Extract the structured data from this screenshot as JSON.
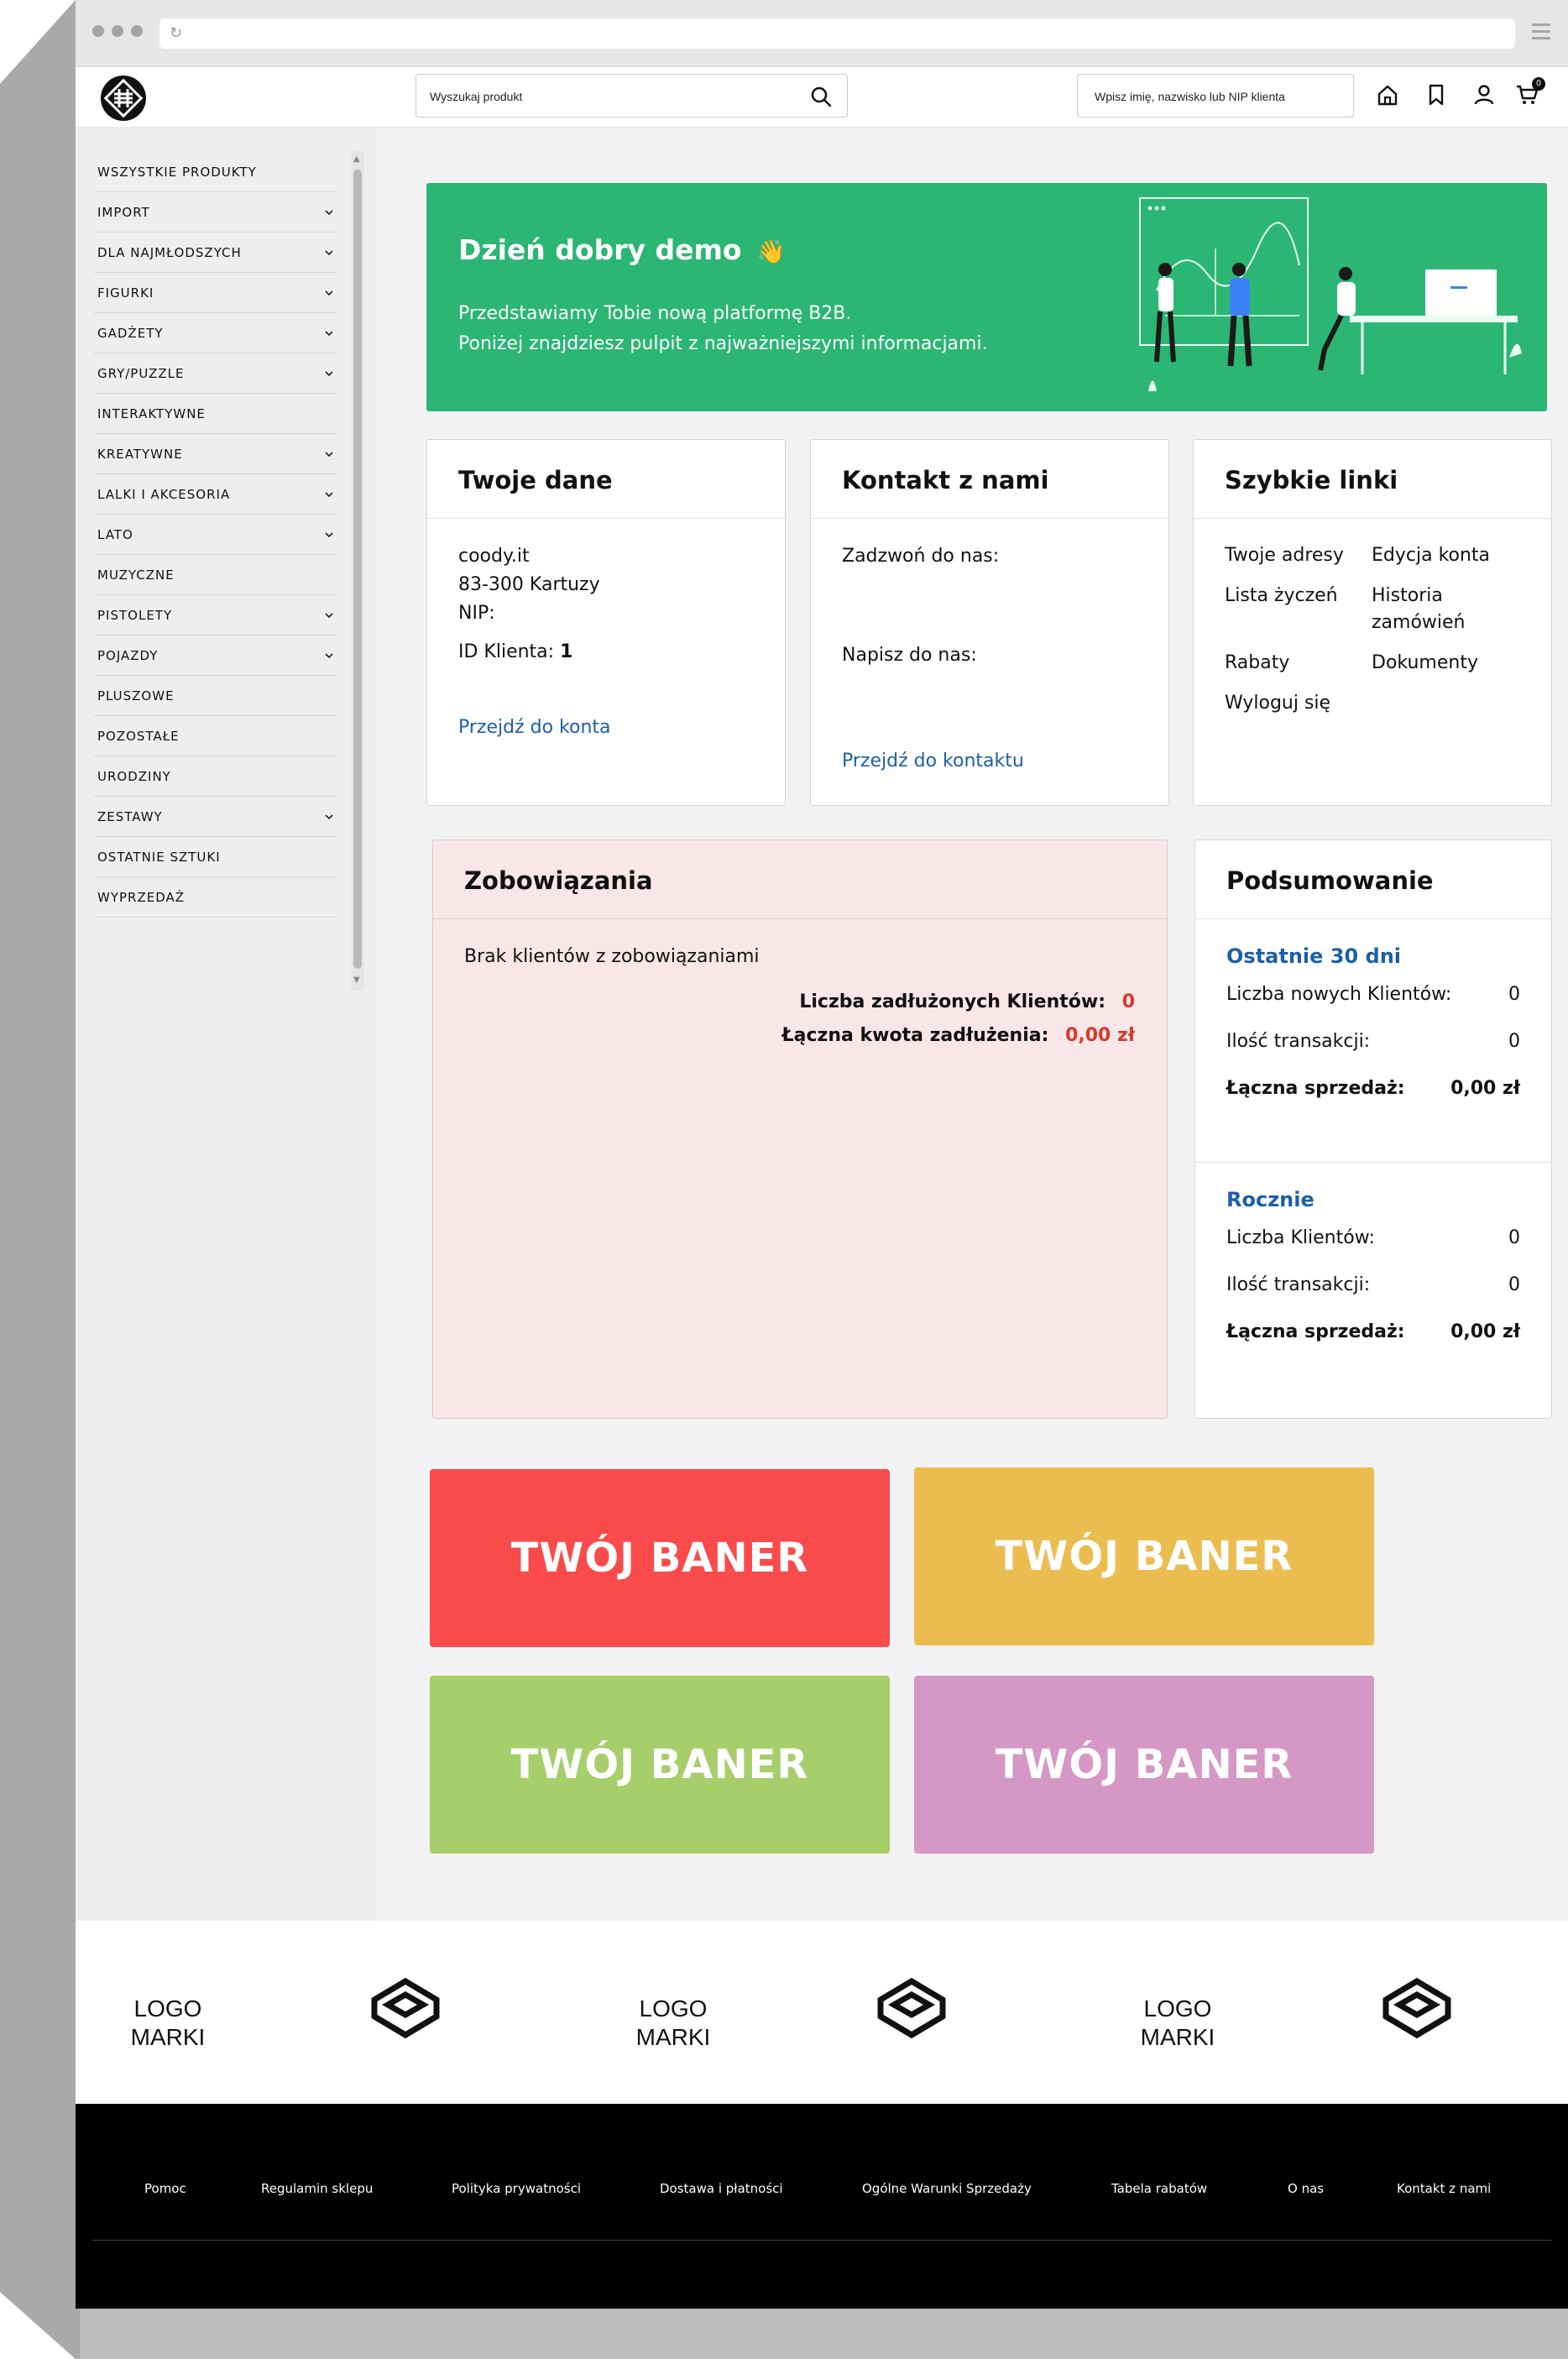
{
  "header": {
    "search_placeholder": "Wyszukaj produkt",
    "client_search_placeholder": "Wpisz imię, nazwisko lub NIP klienta",
    "cart_count": "0"
  },
  "sidebar": {
    "items": [
      {
        "label": "WSZYSTKIE PRODUKTY",
        "has_children": false
      },
      {
        "label": "IMPORT",
        "has_children": true
      },
      {
        "label": "DLA NAJMŁODSZYCH",
        "has_children": true
      },
      {
        "label": "FIGURKI",
        "has_children": true
      },
      {
        "label": "GADŻETY",
        "has_children": true
      },
      {
        "label": "GRY/PUZZLE",
        "has_children": true
      },
      {
        "label": "INTERAKTYWNE",
        "has_children": false
      },
      {
        "label": "KREATYWNE",
        "has_children": true
      },
      {
        "label": "LALKI I AKCESORIA",
        "has_children": true
      },
      {
        "label": "LATO",
        "has_children": true
      },
      {
        "label": "MUZYCZNE",
        "has_children": false
      },
      {
        "label": "PISTOLETY",
        "has_children": true
      },
      {
        "label": "POJAZDY",
        "has_children": true
      },
      {
        "label": "PLUSZOWE",
        "has_children": false
      },
      {
        "label": "POZOSTAŁE",
        "has_children": false
      },
      {
        "label": "URODZINY",
        "has_children": false
      },
      {
        "label": "ZESTAWY",
        "has_children": true
      },
      {
        "label": "OSTATNIE SZTUKI",
        "has_children": false
      },
      {
        "label": "WYPRZEDAŻ",
        "has_children": false
      }
    ]
  },
  "hero": {
    "title": "Dzień dobry demo",
    "emoji": "👋",
    "line1": "Przedstawiamy Tobie nową platformę B2B.",
    "line2": "Poniżej znajdziesz pulpit z najważniejszymi informacjami.",
    "bg_color": "#2bb673"
  },
  "your_data": {
    "title": "Twoje dane",
    "company": "coody.it",
    "address": "83-300 Kartuzy",
    "nip_label": "NIP:",
    "client_id_label": "ID Klienta:",
    "client_id": "1",
    "link": "Przejdź do konta"
  },
  "contact": {
    "title": "Kontakt z nami",
    "call_label": "Zadzwoń do nas:",
    "write_label": "Napisz do nas:",
    "link": "Przejdź do kontaktu"
  },
  "quick_links": {
    "title": "Szybkie linki",
    "links": [
      "Twoje adresy",
      "Edycja konta",
      "Lista życzeń",
      "Historia zamówień",
      "Rabaty",
      "Dokumenty",
      "Wyloguj się"
    ]
  },
  "obligations": {
    "title": "Zobowiązania",
    "empty_text": "Brak klientów z zobowiązaniami",
    "indebted_label": "Liczba zadłużonych Klientów:",
    "indebted_value": "0",
    "total_label": "Łączna kwota zadłużenia:",
    "total_value": "0,00 zł"
  },
  "summary": {
    "title": "Podsumowanie",
    "last30": {
      "title": "Ostatnie 30 dni",
      "new_clients_label": "Liczba nowych Klientów:",
      "new_clients": "0",
      "transactions_label": "Ilość transakcji:",
      "transactions": "0",
      "sales_label": "Łączna sprzedaż:",
      "sales": "0,00 zł"
    },
    "yearly": {
      "title": "Rocznie",
      "clients_label": "Liczba Klientów:",
      "clients": "0",
      "transactions_label": "Ilość transakcji:",
      "transactions": "0",
      "sales_label": "Łączna sprzedaż:",
      "sales": "0,00 zł"
    }
  },
  "banners": [
    {
      "label": "TWÓJ BANER",
      "color": "#f94b4b"
    },
    {
      "label": "TWÓJ BANER",
      "color": "#ebbd50"
    },
    {
      "label": "TWÓJ BANER",
      "color": "#a6ce6a"
    },
    {
      "label": "TWÓJ BANER",
      "color": "#d597c6"
    }
  ],
  "brands": [
    {
      "text_line1": "LOGO",
      "text_line2": "MARKI"
    },
    {
      "text_line1": "LOGO",
      "text_line2": "MARKI"
    },
    {
      "text_line1": "LOGO",
      "text_line2": "MARKI"
    }
  ],
  "footer": {
    "links": [
      "Pomoc",
      "Regulamin sklepu",
      "Polityka prywatności",
      "Dostawa i płatności",
      "Ogólne Warunki Sprzedaży",
      "Tabela rabatów",
      "O nas",
      "Kontakt z nami"
    ]
  }
}
